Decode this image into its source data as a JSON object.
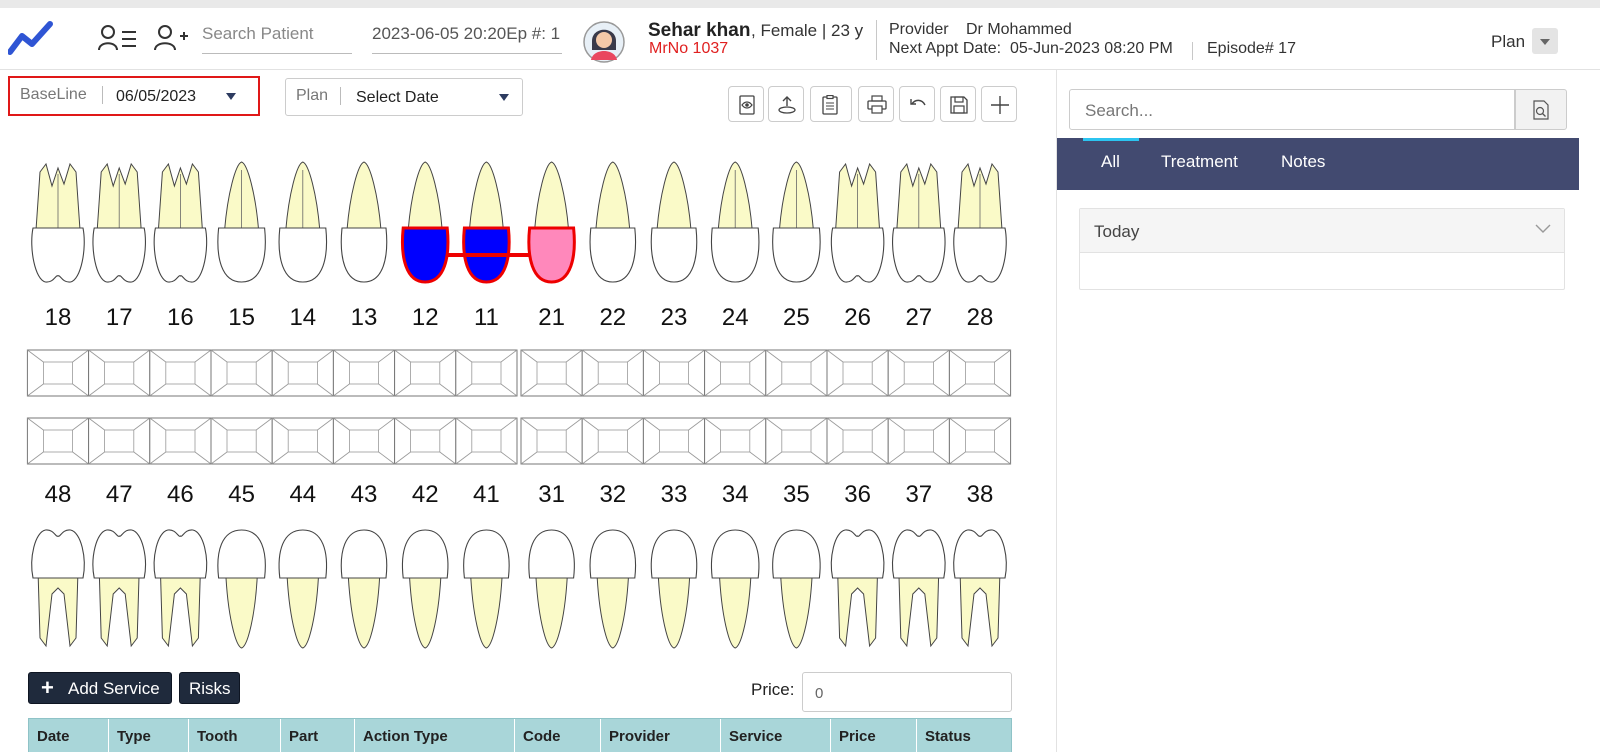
{
  "header": {
    "search_placeholder": "Search Patient",
    "datetime_episode": "2023-06-05 20:20Ep #: 1",
    "patient_name": "Sehar khan",
    "patient_info": ", Female | 23 y",
    "mrno": "MrNo 1037",
    "provider_label": "Provider",
    "provider_name": "Dr Mohammed",
    "next_appt_label": "Next Appt Date:",
    "next_appt_value": "05-Jun-2023 08:20 PM",
    "episode": "Episode# 17",
    "plan_label": "Plan",
    "brand_color": "#2f55d4"
  },
  "toolbar": {
    "baseline_label": "BaseLine",
    "baseline_value": "06/05/2023",
    "plan_label": "Plan",
    "plan_value": "Select Date",
    "icons": [
      "eye-icon",
      "upload-icon",
      "clipboard-icon",
      "print-icon",
      "undo-icon",
      "save-icon",
      "plus-icon"
    ]
  },
  "chart": {
    "upper": [
      "18",
      "17",
      "16",
      "15",
      "14",
      "13",
      "12",
      "11",
      "21",
      "22",
      "23",
      "24",
      "25",
      "26",
      "27",
      "28"
    ],
    "lower": [
      "48",
      "47",
      "46",
      "45",
      "44",
      "43",
      "42",
      "41",
      "31",
      "32",
      "33",
      "34",
      "35",
      "36",
      "37",
      "38"
    ],
    "marked": {
      "12": "#0000ff",
      "11": "#0000ff",
      "21": "#ff88bb"
    },
    "bridge": [
      "12",
      "11",
      "21"
    ],
    "outline_color": "#ee0000",
    "root_color": "#fafac8"
  },
  "actions": {
    "add_service": "Add Service",
    "risks": "Risks",
    "price_label": "Price:",
    "price_value": "0"
  },
  "table": {
    "columns": [
      "Date",
      "Type",
      "Tooth",
      "Part",
      "Action Type",
      "Code",
      "Provider",
      "Service",
      "Price",
      "Status"
    ]
  },
  "sidebar": {
    "search_placeholder": "Search...",
    "tabs": [
      "All",
      "Treatment",
      "Notes"
    ],
    "section": "Today"
  }
}
